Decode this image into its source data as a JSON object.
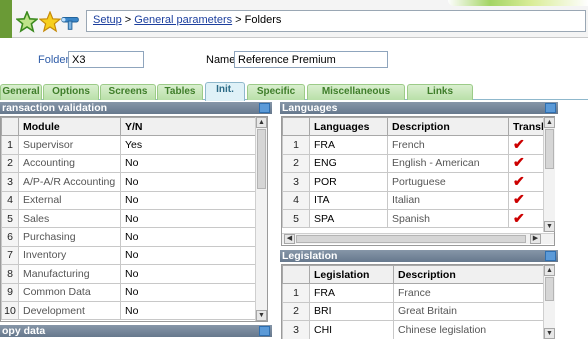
{
  "breadcrumb": {
    "setup": "Setup",
    "sep1": " > ",
    "general_parameters": "General parameters",
    "sep2": " > ",
    "current": "Folders"
  },
  "header": {
    "folder_label": "Folder",
    "folder_value": "X3",
    "name_label": "Name",
    "name_value": "Reference Premium"
  },
  "tabs": [
    "General",
    "Options",
    "Screens",
    "Tables",
    "Init.",
    "Specific",
    "Miscellaneous",
    "Links"
  ],
  "active_tab": "Init.",
  "transaction_validation": {
    "title": "ransaction validation",
    "columns": [
      "",
      "Module",
      "Y/N"
    ],
    "rows": [
      [
        "1",
        "Supervisor",
        "Yes"
      ],
      [
        "2",
        "Accounting",
        "No"
      ],
      [
        "3",
        "A/P-A/R Accounting",
        "No"
      ],
      [
        "4",
        "External",
        "No"
      ],
      [
        "5",
        "Sales",
        "No"
      ],
      [
        "6",
        "Purchasing",
        "No"
      ],
      [
        "7",
        "Inventory",
        "No"
      ],
      [
        "8",
        "Manufacturing",
        "No"
      ],
      [
        "9",
        "Common Data",
        "No"
      ],
      [
        "10",
        "Development",
        "No"
      ]
    ]
  },
  "copy_data": {
    "title": "opy data"
  },
  "languages": {
    "title": "Languages",
    "columns": [
      "",
      "Languages",
      "Description",
      "Transla"
    ],
    "rows": [
      [
        "1",
        "FRA",
        "French",
        true
      ],
      [
        "2",
        "ENG",
        "English - American",
        true
      ],
      [
        "3",
        "POR",
        "Portuguese",
        true
      ],
      [
        "4",
        "ITA",
        "Italian",
        true
      ],
      [
        "5",
        "SPA",
        "Spanish",
        true
      ]
    ]
  },
  "legislation": {
    "title": "Legislation",
    "columns": [
      "",
      "Legislation",
      "Description"
    ],
    "rows": [
      [
        "1",
        "FRA",
        "France"
      ],
      [
        "2",
        "BRI",
        "Great Britain"
      ],
      [
        "3",
        "CHI",
        "Chinese legislation"
      ]
    ]
  },
  "colors": {
    "tab_text": "#3f7e2a",
    "panel_title_bg": "#6d7f94",
    "check": "#cc0000",
    "link": "#1c3f9e"
  }
}
